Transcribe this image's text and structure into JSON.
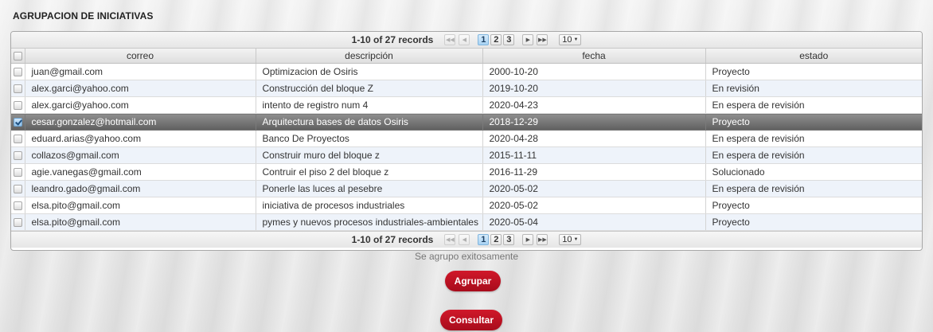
{
  "panel": {
    "title": "AGRUPACION DE INICIATIVAS"
  },
  "paginator": {
    "records_label": "1-10 of 27 records",
    "pages": [
      "1",
      "2",
      "3"
    ],
    "current_page": "1",
    "rows_per_page": "10"
  },
  "table": {
    "columns": [
      "correo",
      "descripción",
      "fecha",
      "estado"
    ],
    "rows": [
      {
        "correo": "juan@gmail.com",
        "descripcion": "Optimizacion de Osiris",
        "fecha": "2000-10-20",
        "estado": "Proyecto",
        "selected": false
      },
      {
        "correo": "alex.garci@yahoo.com",
        "descripcion": "Construcción del bloque Z",
        "fecha": "2019-10-20",
        "estado": "En revisión",
        "selected": false
      },
      {
        "correo": "alex.garci@yahoo.com",
        "descripcion": "intento de registro num 4",
        "fecha": "2020-04-23",
        "estado": "En espera de revisión",
        "selected": false
      },
      {
        "correo": "cesar.gonzalez@hotmail.com",
        "descripcion": "Arquitectura bases de datos Osiris",
        "fecha": "2018-12-29",
        "estado": "Proyecto",
        "selected": true
      },
      {
        "correo": "eduard.arias@yahoo.com",
        "descripcion": "Banco De Proyectos",
        "fecha": "2020-04-28",
        "estado": "En espera de revisión",
        "selected": false
      },
      {
        "correo": "collazos@gmail.com",
        "descripcion": "Construir muro del bloque z",
        "fecha": "2015-11-11",
        "estado": "En espera de revisión",
        "selected": false
      },
      {
        "correo": "agie.vanegas@gmail.com",
        "descripcion": "Contruir el piso 2 del bloque z",
        "fecha": "2016-11-29",
        "estado": "Solucionado",
        "selected": false
      },
      {
        "correo": "leandro.gado@gmail.com",
        "descripcion": "Ponerle las luces al pesebre",
        "fecha": "2020-05-02",
        "estado": "En espera de revisión",
        "selected": false
      },
      {
        "correo": "elsa.pito@gmail.com",
        "descripcion": "iniciativa de procesos industriales",
        "fecha": "2020-05-02",
        "estado": "Proyecto",
        "selected": false
      },
      {
        "correo": "elsa.pito@gmail.com",
        "descripcion": "pymes y nuevos procesos industriales-ambientales",
        "fecha": "2020-05-04",
        "estado": "Proyecto",
        "selected": false
      }
    ]
  },
  "status_message": "Se agrupo exitosamente",
  "buttons": {
    "agrupar": "Agrupar",
    "consultar": "Consultar"
  },
  "colors": {
    "accent_button": "#c0142a",
    "selected_row": "#707070",
    "current_page": "#a8d2f3"
  }
}
